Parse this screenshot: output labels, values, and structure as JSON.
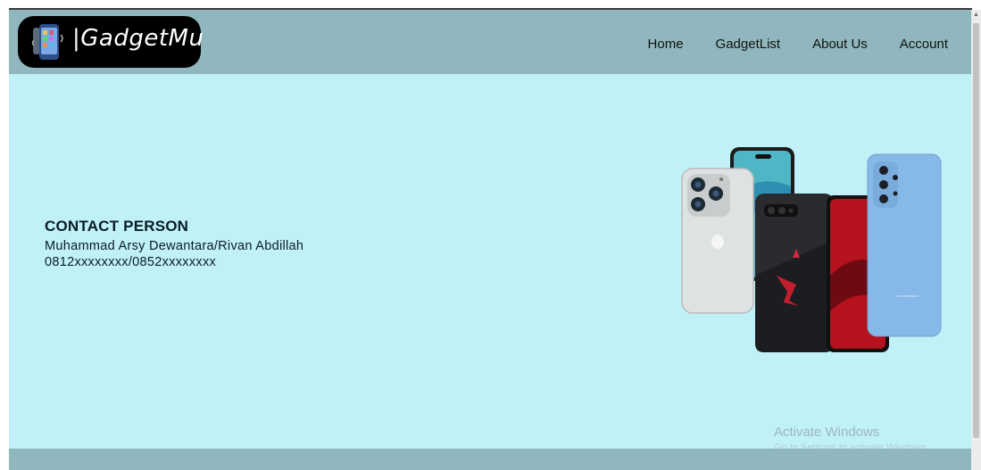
{
  "brand": {
    "name": "|GadgetMu",
    "logo_icon": "phone-icon"
  },
  "nav": {
    "items": [
      {
        "label": "Home"
      },
      {
        "label": "GadgetList"
      },
      {
        "label": "About Us"
      },
      {
        "label": "Account"
      }
    ]
  },
  "contact": {
    "title": "CONTACT PERSON",
    "names": "Muhammad Arsy Dewantara/Rivan Abdillah",
    "phones": "0812xxxxxxxx/0852xxxxxxxx"
  },
  "watermark": {
    "title": "Activate Windows",
    "subtitle": "Go to Settings to activate Windows."
  },
  "colors": {
    "page_bg": "#bff1f7",
    "navbar_bg": "#8fb7bd",
    "logo_bg": "#000000"
  }
}
